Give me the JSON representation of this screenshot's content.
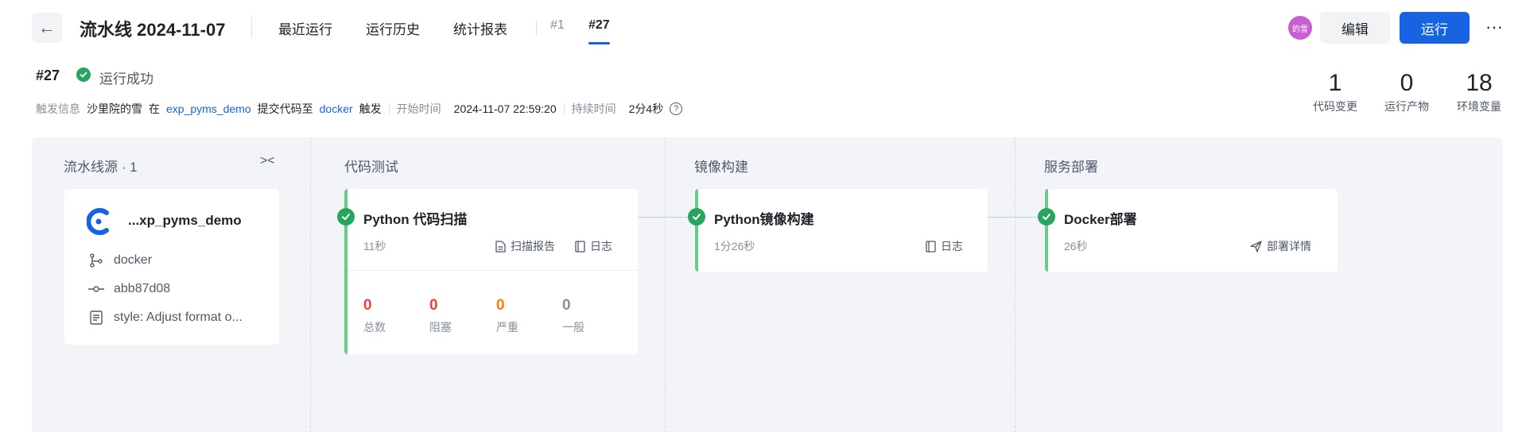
{
  "header": {
    "back_glyph": "←",
    "title": "流水线 2024-11-07",
    "nav_tabs": [
      "最近运行",
      "运行历史",
      "统计报表"
    ],
    "run_tabs": [
      "#1",
      "#27"
    ],
    "active_run_tab": "#27",
    "avatar_text": "的雪",
    "avatar_color": "#c75fd0",
    "edit_label": "编辑",
    "run_label": "运行",
    "more_glyph": "···",
    "accent_color": "#1664e1"
  },
  "run": {
    "number": "#27",
    "status": "运行成功",
    "status_color": "#25a55d",
    "trigger_label": "触发信息",
    "trigger_user": "沙里院的雪",
    "trigger_at": "在",
    "trigger_repo": "exp_pyms_demo",
    "trigger_action": "提交代码至",
    "trigger_branch": "docker",
    "trigger_suffix": "触发",
    "start_label": "开始时间",
    "start_time": "2024-11-07 22:59:20",
    "duration_label": "持续时间",
    "duration": "2分4秒",
    "help_glyph": "?"
  },
  "stats": [
    {
      "value": "1",
      "label": "代码变更"
    },
    {
      "value": "0",
      "label": "运行产物"
    },
    {
      "value": "18",
      "label": "环境变量"
    }
  ],
  "source": {
    "title": "流水线源 · 1",
    "collapse_glyph": "><",
    "repo_name": "...xp_pyms_demo",
    "branch": "docker",
    "commit": "abb87d08",
    "message": "style: Adjust format o..."
  },
  "stages": [
    {
      "title": "代码测试",
      "job": {
        "name": "Python 代码扫描",
        "time": "11秒",
        "actions": [
          "扫描报告",
          "日志"
        ],
        "scan": [
          {
            "value": "0",
            "label": "总数",
            "color": "#f53f3f"
          },
          {
            "value": "0",
            "label": "阻塞",
            "color": "#f53f3f"
          },
          {
            "value": "0",
            "label": "严重",
            "color": "#ff7d00"
          },
          {
            "value": "0",
            "label": "一般",
            "color": "#86909c"
          }
        ]
      }
    },
    {
      "title": "镜像构建",
      "job": {
        "name": "Python镜像构建",
        "time": "1分26秒",
        "actions": [
          "日志"
        ]
      }
    },
    {
      "title": "服务部署",
      "job": {
        "name": "Docker部署",
        "time": "26秒",
        "actions": [
          "部署详情"
        ]
      }
    }
  ]
}
